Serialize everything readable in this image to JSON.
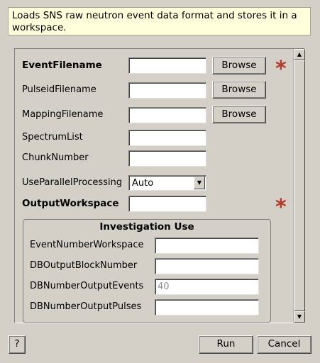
{
  "description": "Loads SNS raw neutron event data format and stores it in a workspace.",
  "fields": {
    "event_filename": {
      "label": "EventFilename",
      "value": "",
      "browse": "Browse"
    },
    "pulseid_filename": {
      "label": "PulseidFilename",
      "value": "",
      "browse": "Browse"
    },
    "mapping_filename": {
      "label": "MappingFilename",
      "value": "",
      "browse": "Browse"
    },
    "spectrum_list": {
      "label": "SpectrumList",
      "value": ""
    },
    "chunk_number": {
      "label": "ChunkNumber",
      "value": ""
    },
    "use_parallel": {
      "label": "UseParallelProcessing",
      "value": "Auto"
    },
    "output_workspace": {
      "label": "OutputWorkspace",
      "value": ""
    }
  },
  "required_marker": "*",
  "investigation": {
    "title": "Investigation Use",
    "event_number_workspace": {
      "label": "EventNumberWorkspace",
      "value": ""
    },
    "db_output_block_number": {
      "label": "DBOutputBlockNumber",
      "value": ""
    },
    "db_number_output_events": {
      "label": "DBNumberOutputEvents",
      "value": "40"
    },
    "db_number_output_pulses": {
      "label": "DBNumberOutputPulses",
      "value": ""
    }
  },
  "footer": {
    "help": "?",
    "run": "Run",
    "cancel": "Cancel"
  },
  "icons": {
    "scroll_up": "triangle-up",
    "scroll_down": "triangle-down",
    "dropdown": "triangle-down"
  }
}
